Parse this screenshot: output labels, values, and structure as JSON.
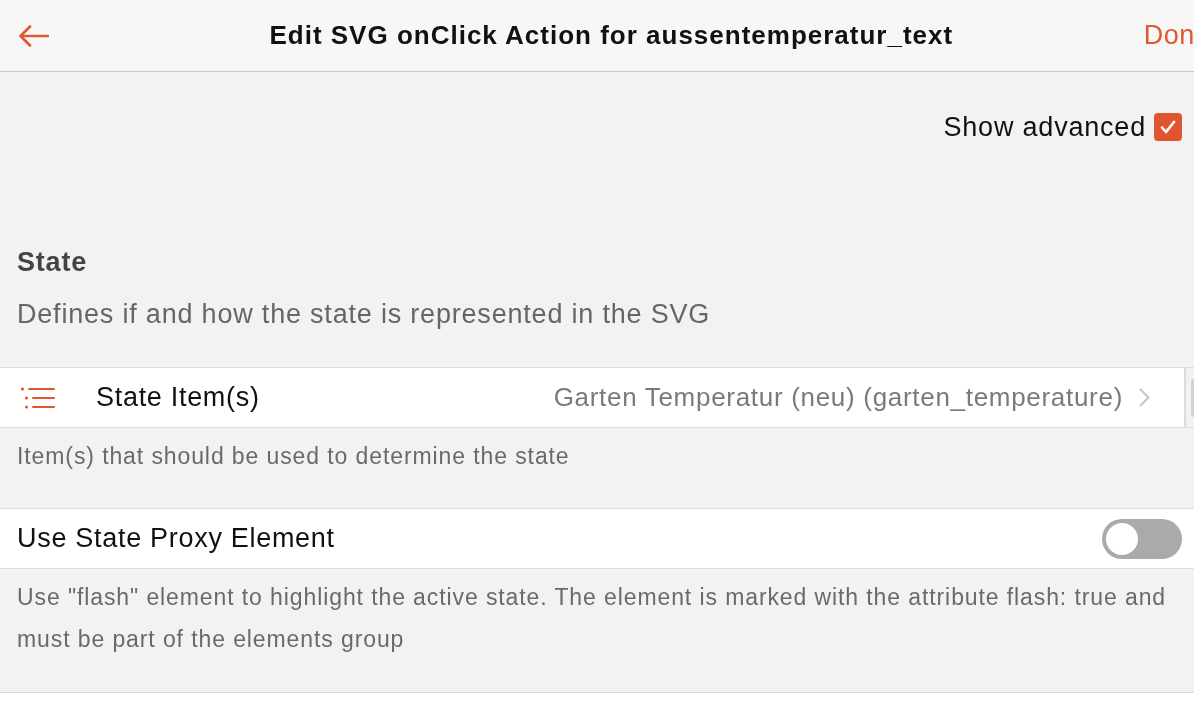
{
  "header": {
    "title": "Edit SVG onClick Action for aussentemperatur_text",
    "done_label": "Don"
  },
  "show_advanced": {
    "label": "Show advanced",
    "checked": true
  },
  "section": {
    "title": "State",
    "description": "Defines if and how the state is represented in the SVG"
  },
  "settings": [
    {
      "kind": "picker",
      "label": "State Item(s)",
      "value": "Garten Temperatur (neu) (garten_temperature)",
      "hint": "Item(s) that should be used to determine the state"
    },
    {
      "kind": "toggle",
      "label": "Use State Proxy Element",
      "on": false,
      "hint": "Use \"flash\" element to highlight the active state. The element is marked with the attribute flash: true and must be part of the elements group"
    }
  ]
}
